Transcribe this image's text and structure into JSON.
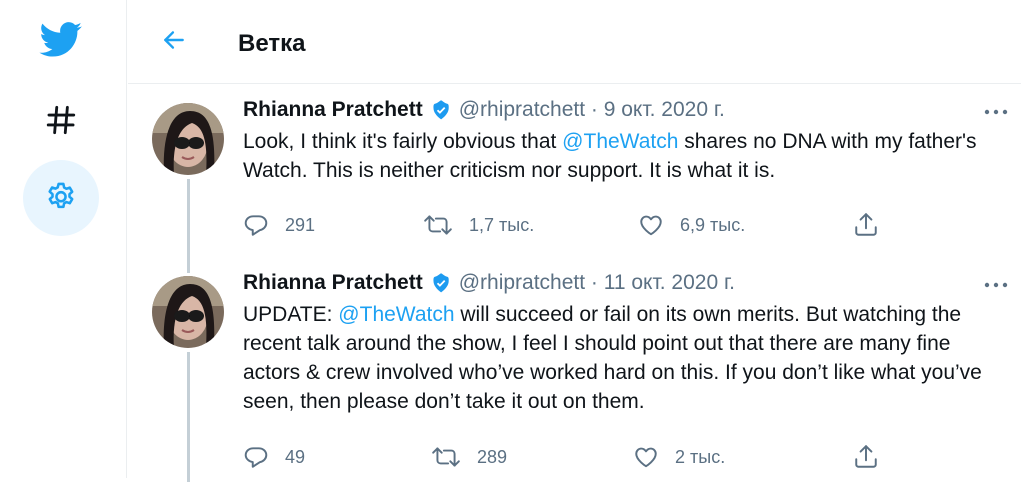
{
  "header": {
    "title": "Ветка"
  },
  "sidebar": {
    "icons": [
      "twitter-logo-icon",
      "hashtag-icon",
      "gear-icon"
    ]
  },
  "colors": {
    "accent": "#1da1f2",
    "verified": "#1d9bf0",
    "secondary_text": "#5b7083"
  },
  "tweets": [
    {
      "name": "Rhianna Pratchett",
      "meta": "@rhipratchett · 9 окт. 2020 г.",
      "text_before": "Look, I think it's fairly obvious that ",
      "mention": "@TheWatch",
      "text_after": " shares no DNA with my father's Watch. This is neither criticism nor support. It is what it is.",
      "replies": "291",
      "retweets": "1,7 тыс.",
      "likes": "6,9 тыс."
    },
    {
      "name": "Rhianna Pratchett",
      "meta": "@rhipratchett · 11 окт. 2020 г.",
      "text_before": "UPDATE: ",
      "mention": "@TheWatch",
      "text_after": " will succeed or fail on its own merits. But watching the recent talk around the show, I feel I should point out that there are many fine actors & crew involved who’ve worked hard on this. If you don’t like what you’ve seen, then please don’t take it out on them.",
      "replies": "49",
      "retweets": "289",
      "likes": "2 тыс."
    }
  ]
}
